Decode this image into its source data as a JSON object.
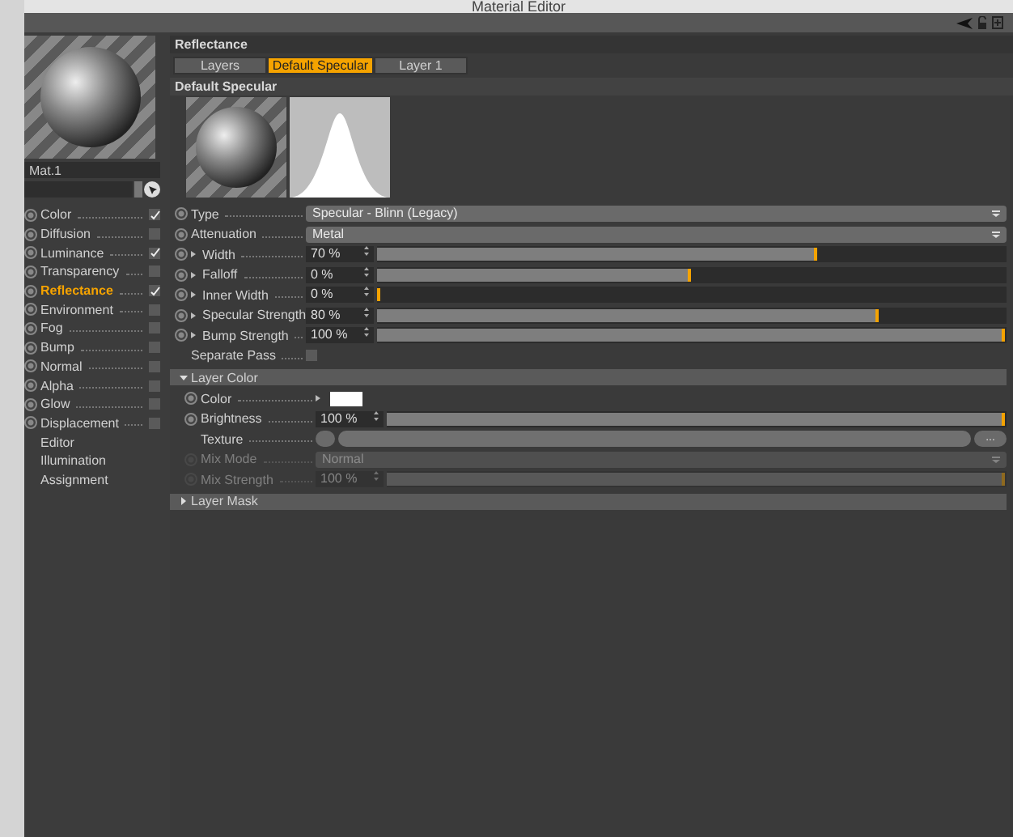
{
  "window": {
    "title": "Material Editor"
  },
  "material": {
    "name": "Mat.1"
  },
  "channels": [
    {
      "label": "Color",
      "kind": "channel",
      "checked": true,
      "selected": false
    },
    {
      "label": "Diffusion",
      "kind": "channel",
      "checked": false,
      "selected": false
    },
    {
      "label": "Luminance",
      "kind": "channel",
      "checked": true,
      "selected": false
    },
    {
      "label": "Transparency",
      "kind": "channel",
      "checked": false,
      "selected": false
    },
    {
      "label": "Reflectance",
      "kind": "channel",
      "checked": true,
      "selected": true
    },
    {
      "label": "Environment",
      "kind": "channel",
      "checked": false,
      "selected": false
    },
    {
      "label": "Fog",
      "kind": "channel",
      "checked": false,
      "selected": false
    },
    {
      "label": "Bump",
      "kind": "channel",
      "checked": false,
      "selected": false
    },
    {
      "label": "Normal",
      "kind": "channel",
      "checked": false,
      "selected": false
    },
    {
      "label": "Alpha",
      "kind": "channel",
      "checked": false,
      "selected": false
    },
    {
      "label": "Glow",
      "kind": "channel",
      "checked": false,
      "selected": false
    },
    {
      "label": "Displacement",
      "kind": "channel",
      "checked": false,
      "selected": false
    },
    {
      "label": "Editor",
      "kind": "page",
      "selected": false
    },
    {
      "label": "Illumination",
      "kind": "page",
      "selected": false
    },
    {
      "label": "Assignment",
      "kind": "page",
      "selected": false
    }
  ],
  "panel": {
    "title": "Reflectance",
    "tabs": [
      {
        "label": "Layers",
        "selected": false
      },
      {
        "label": "Default Specular",
        "selected": true
      },
      {
        "label": "Layer 1",
        "selected": false
      }
    ],
    "layer_title": "Default Specular",
    "params": [
      {
        "kind": "dropdown",
        "label": "Type",
        "value": "Specular - Blinn (Legacy)"
      },
      {
        "kind": "dropdown",
        "label": "Attenuation",
        "value": "Metal"
      },
      {
        "kind": "slider",
        "label": "Width",
        "value": "70 %",
        "level": 0.7
      },
      {
        "kind": "slider",
        "label": "Falloff",
        "value": "0 %",
        "level": 0.5
      },
      {
        "kind": "slider",
        "label": "Inner Width",
        "value": "0 %",
        "level": 0
      },
      {
        "kind": "slider",
        "label": "Specular Strength",
        "value": "80 %",
        "level": 0.8
      },
      {
        "kind": "slider",
        "label": "Bump Strength",
        "value": "100 %",
        "level": 1
      },
      {
        "kind": "checkbox",
        "label": "Separate Pass",
        "checked": false
      }
    ],
    "sections": [
      {
        "title": "Layer Color",
        "expanded": true,
        "params": [
          {
            "kind": "color",
            "label": "Color",
            "color": "#ffffff",
            "disabled": false
          },
          {
            "kind": "slider",
            "label": "Brightness",
            "value": "100 %",
            "level": 1,
            "disabled": false
          },
          {
            "kind": "texture",
            "label": "Texture",
            "button": "...",
            "disabled": false
          },
          {
            "kind": "dropdown",
            "label": "Mix Mode",
            "value": "Normal",
            "disabled": true
          },
          {
            "kind": "slider",
            "label": "Mix Strength",
            "value": "100 %",
            "level": 1,
            "disabled": true
          }
        ]
      },
      {
        "title": "Layer Mask",
        "expanded": false
      }
    ]
  }
}
